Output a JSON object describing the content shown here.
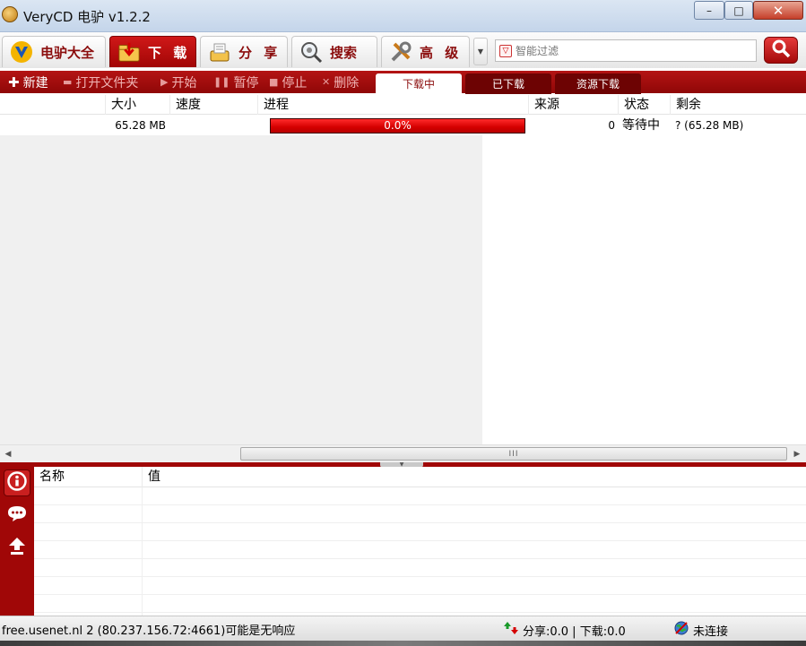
{
  "window": {
    "title": "VeryCD 电驴 v1.2.2",
    "minimize_label": "–",
    "maximize_label": "□",
    "close_label": "✕"
  },
  "main_tabs": [
    {
      "label": "电驴大全",
      "icon": "verycd-logo-icon",
      "active": false
    },
    {
      "label": "下 载",
      "icon": "download-folder-icon",
      "active": true
    },
    {
      "label": "分 享",
      "icon": "share-icon",
      "active": false
    },
    {
      "label": "搜索",
      "icon": "search-magnifier-icon",
      "active": false
    },
    {
      "label": "高 级",
      "icon": "tools-icon",
      "active": false
    }
  ],
  "filter": {
    "placeholder": "智能过滤"
  },
  "toolbar": {
    "new_label": "新建",
    "open_folder_label": "打开文件夹",
    "start_label": "开始",
    "pause_label": "暂停",
    "stop_label": "停止",
    "delete_label": "删除"
  },
  "sub_tabs": {
    "downloading": "下载中",
    "downloaded": "已下载",
    "resource_download": "资源下载"
  },
  "download_table": {
    "columns": {
      "size": "大小",
      "speed": "速度",
      "progress": "进程",
      "sources": "来源",
      "status": "状态",
      "remaining": "剩余"
    },
    "rows": [
      {
        "size": "65.28 MB",
        "speed": "",
        "progress_text": "0.0%",
        "progress_fraction": 0.0,
        "sources": "0",
        "status": "等待中",
        "remaining": "? (65.28 MB)"
      }
    ]
  },
  "info_table": {
    "columns": {
      "name": "名称",
      "value": "值"
    }
  },
  "sidebar_icons": [
    "info-icon",
    "chat-icon",
    "upload-icon"
  ],
  "statusbar": {
    "server": "free.usenet.nl 2 (80.237.156.72:4661)可能是无响应",
    "share_download": "分享:0.0 | 下载:0.0",
    "connection": "未连接"
  },
  "colors": {
    "accent_red": "#a00707",
    "progress_red": "#e00000"
  }
}
